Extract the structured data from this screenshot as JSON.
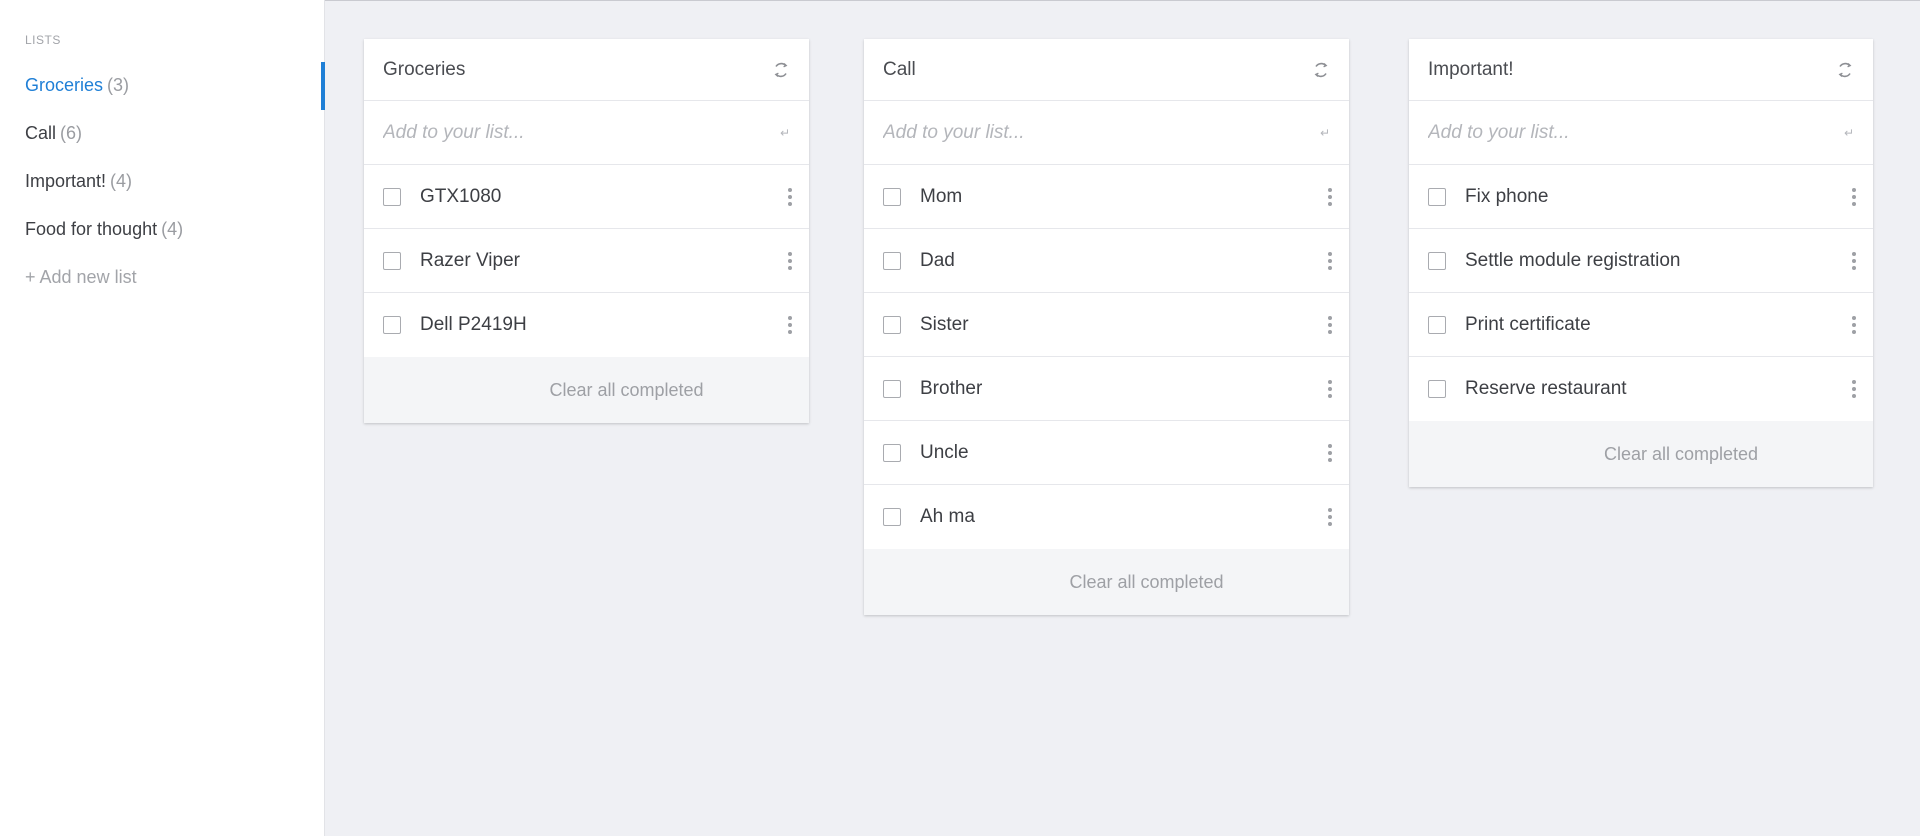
{
  "sidebar": {
    "heading": "LISTS",
    "items": [
      {
        "label": "Groceries",
        "count": "(3)"
      },
      {
        "label": "Call",
        "count": "(6)"
      },
      {
        "label": "Important!",
        "count": "(4)"
      },
      {
        "label": "Food for thought",
        "count": "(4)"
      }
    ],
    "add_label": "+ Add new list",
    "active_index": 0
  },
  "colors": {
    "accent": "#1f7fd6",
    "background": "#eff0f4",
    "card": "#ffffff",
    "footer": "#f4f5f7"
  },
  "icons": {
    "refresh": "refresh-icon",
    "enter": "enter-icon",
    "menu": "kebab-menu-icon",
    "checkbox": "checkbox"
  },
  "cards": [
    {
      "title": "Groceries",
      "placeholder": "Add to your list...",
      "enter_glyph": "↵",
      "items": [
        "GTX1080",
        "Razer Viper",
        "Dell P2419H"
      ],
      "footer": "Clear all completed"
    },
    {
      "title": "Call",
      "placeholder": "Add to your list...",
      "enter_glyph": "↵",
      "items": [
        "Mom",
        "Dad",
        "Sister",
        "Brother",
        "Uncle",
        "Ah ma"
      ],
      "footer": "Clear all completed"
    },
    {
      "title": "Important!",
      "placeholder": "Add to your list...",
      "enter_glyph": "↵",
      "items": [
        "Fix phone",
        "Settle module registration",
        "Print certificate",
        "Reserve restaurant"
      ],
      "footer": "Clear all completed"
    }
  ]
}
